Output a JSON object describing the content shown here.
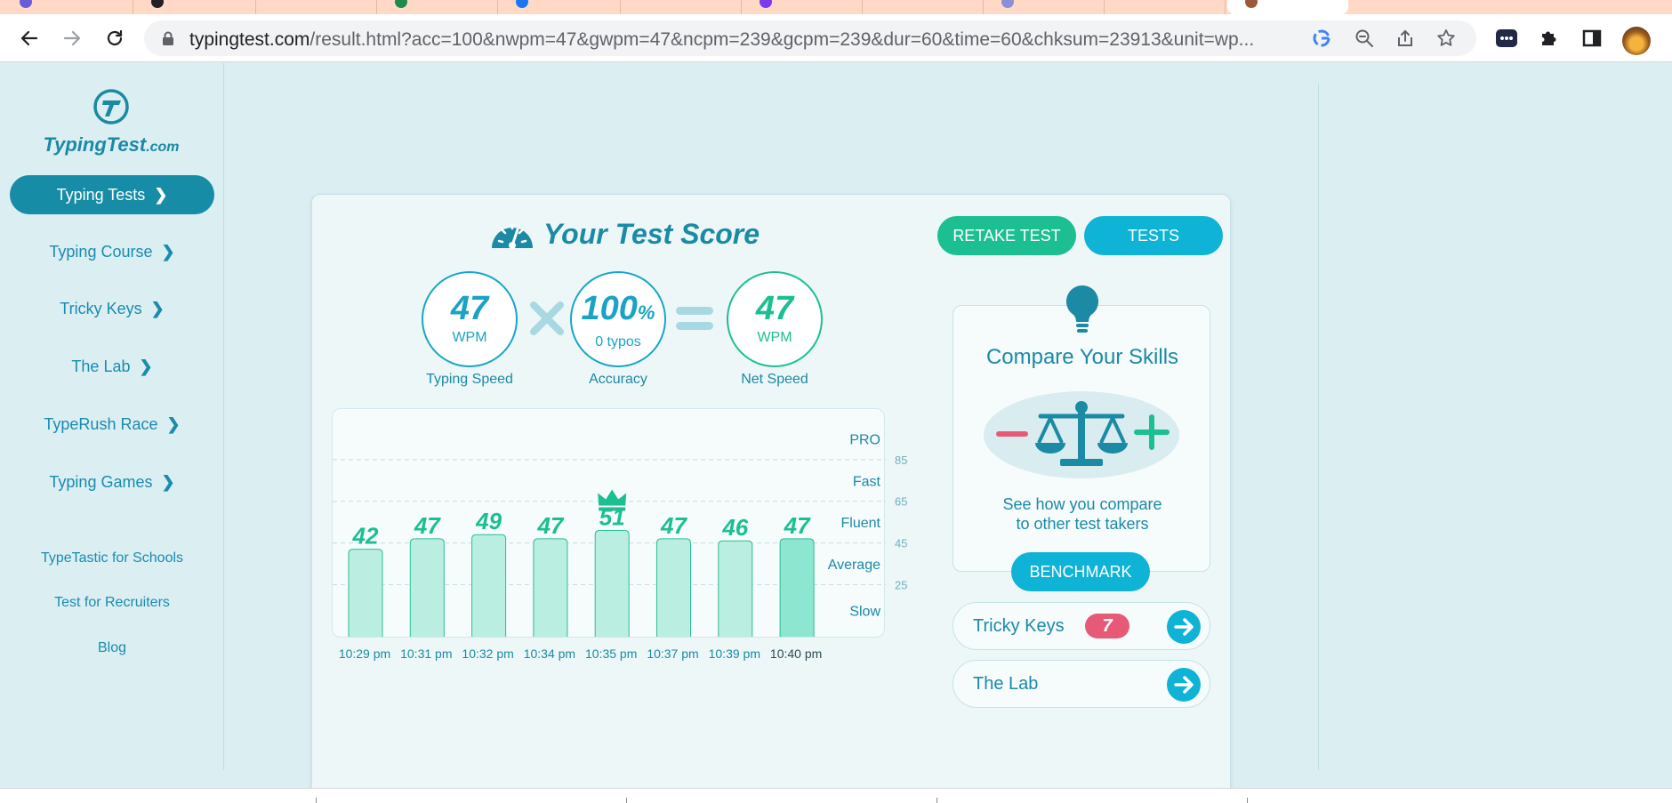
{
  "browser": {
    "url_host": "typingtest.com",
    "url_path": "/result.html?acc=100&nwpm=47&gwpm=47&ncpm=239&gcpm=239&dur=60&time=60&chksum=23913&unit=wp..."
  },
  "sidebar": {
    "brand_main": "TypingTest",
    "brand_suffix": ".com",
    "items": [
      {
        "label": "Typing Tests",
        "active": true
      },
      {
        "label": "Typing Course"
      },
      {
        "label": "Tricky Keys"
      },
      {
        "label": "The Lab"
      },
      {
        "label": "TypeRush Race"
      },
      {
        "label": "Typing Games"
      }
    ],
    "links": [
      "TypeTastic for Schools",
      "Test for Recruiters",
      "Blog"
    ]
  },
  "score": {
    "title": "Your Test Score",
    "retake_label": "RETAKE TEST",
    "tests_label": "TESTS",
    "typing_speed": {
      "value": "47",
      "unit": "WPM",
      "label": "Typing Speed"
    },
    "accuracy": {
      "value": "100",
      "pct": "%",
      "unit": "0  typos",
      "label": "Accuracy"
    },
    "net_speed": {
      "value": "47",
      "unit": "WPM",
      "label": "Net Speed"
    }
  },
  "chart_data": {
    "type": "bar",
    "categories": [
      "10:29 pm",
      "10:31 pm",
      "10:32 pm",
      "10:34 pm",
      "10:35 pm",
      "10:37 pm",
      "10:39 pm",
      "10:40 pm"
    ],
    "values": [
      42,
      47,
      49,
      47,
      51,
      47,
      46,
      47
    ],
    "best_index": 4,
    "current_index": 7,
    "ylim": [
      0,
      105
    ],
    "gridlines": [
      25,
      45,
      65,
      85
    ],
    "grid": true,
    "zones": [
      "PRO",
      "Fast",
      "Fluent",
      "Average",
      "Slow"
    ],
    "colors": {
      "bar": "#baeee0",
      "bar_current": "#8de6cf",
      "bar_stroke": "#2bbf96",
      "label": "#1bbf92"
    }
  },
  "compare": {
    "heading": "Compare Your Skills",
    "desc_line1": "See how you compare",
    "desc_line2": "to other test takers",
    "button": "BENCHMARK"
  },
  "quick_links": [
    {
      "label": "Tricky Keys",
      "badge": "7"
    },
    {
      "label": "The Lab"
    }
  ]
}
